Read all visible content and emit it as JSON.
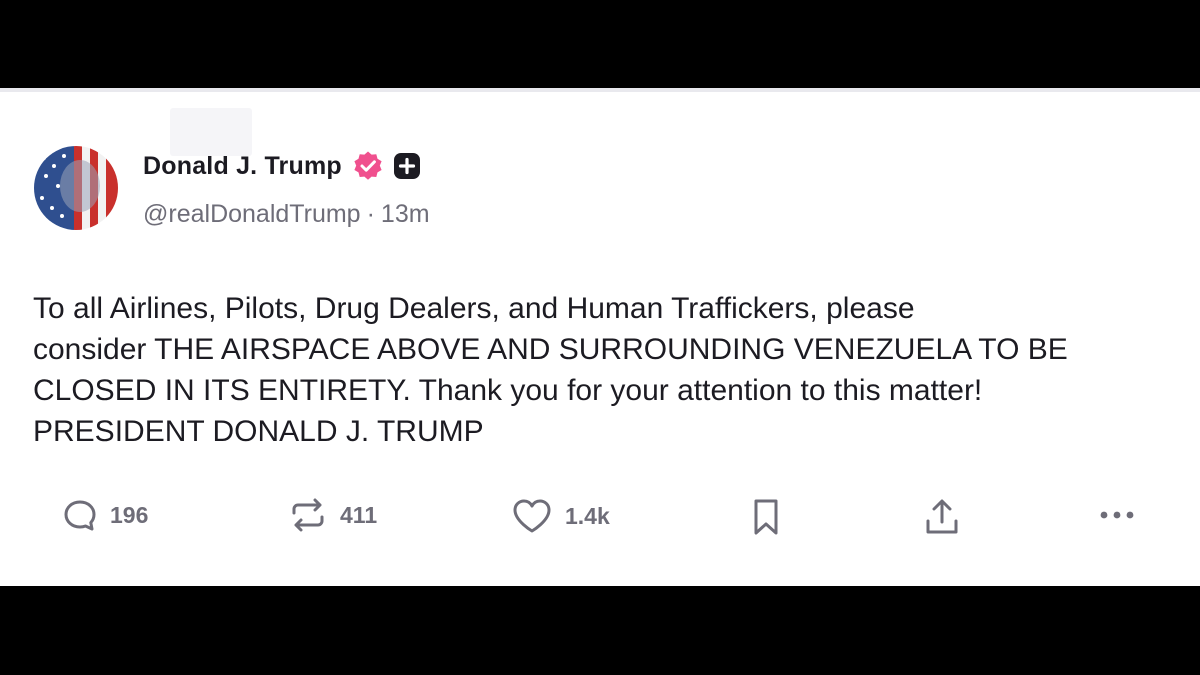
{
  "post": {
    "author_name": "Donald J. Trump",
    "handle": "@realDonaldTrump",
    "separator": "·",
    "time_ago": "13m",
    "text": "To all Airlines, Pilots, Drug Dealers, and Human Traffickers, please\nconsider THE AIRSPACE ABOVE AND SURROUNDING VENEZUELA TO BE\nCLOSED IN ITS ENTIRETY. Thank you for your attention to this matter!\nPRESIDENT DONALD J. TRUMP"
  },
  "actions": {
    "replies": "196",
    "reposts": "411",
    "likes": "1.4k"
  },
  "icons": {
    "verified": "verified-badge-icon",
    "plus": "plus-badge-icon",
    "reply": "reply-icon",
    "repost": "repost-icon",
    "like": "heart-icon",
    "bookmark": "bookmark-icon",
    "share": "share-icon",
    "more": "more-icon"
  },
  "colors": {
    "verified": "#f0508e",
    "text": "#1c1b22",
    "muted": "#6e6d78"
  }
}
